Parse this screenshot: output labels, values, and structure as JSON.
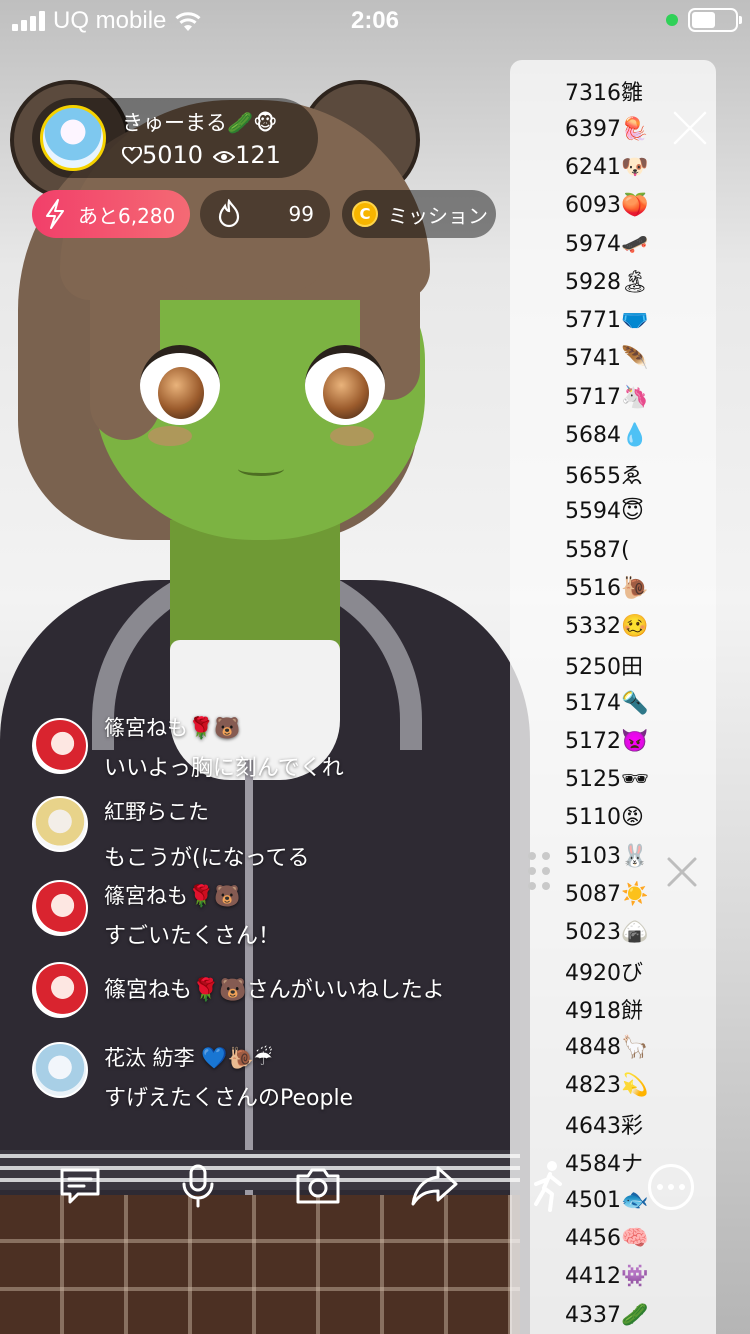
{
  "status_bar": {
    "carrier": "UQ mobile",
    "time": "2:06"
  },
  "streamer": {
    "name": "きゅーまる🥒🐵",
    "likes": "5010",
    "viewers": "121"
  },
  "badges": {
    "remaining": "あと6,280",
    "fire_count": "99",
    "mission": "ミッション",
    "coin_letter": "C"
  },
  "ranking": [
    "7316雛",
    "6397🪼",
    "6241🐶",
    "6093🍑",
    "5974🛹",
    "5928🏝",
    "5771🩲",
    "5741🪶",
    "5717🦄",
    "5684💧",
    "5655ゑ",
    "5594😇",
    "5587(",
    "5516🐌",
    "5332🥴",
    "5250田",
    "5174🔦",
    "5172👿",
    "5125🕶",
    "5110😡",
    "5103🐰",
    "5087☀️",
    "5023🍙",
    "4920び",
    "4918餅",
    "4848🦙",
    "4823💫",
    "4643彩",
    "4584ナ",
    "4501🐟",
    "4456🧠",
    "4412👾",
    "4337🥒"
  ],
  "comments": [
    {
      "name": "篠宮ねも🌹🐻",
      "text": "いいよっ胸に刻んでくれ",
      "avatar": "red"
    },
    {
      "name": "紅野らこた",
      "text": "もこうが(になってる",
      "avatar": "blond"
    },
    {
      "name": "篠宮ねも🌹🐻",
      "text": "すごいたくさん！",
      "avatar": "red"
    },
    {
      "text": "篠宮ねも🌹🐻さんがいいねしたよ",
      "avatar": "red"
    },
    {
      "name": "花汰 紡李 💙🐌☔",
      "text": "すげえたくさんのPeople",
      "avatar": "blue"
    }
  ],
  "colors": {
    "accent": "#f23f6a",
    "coin": "#f7b500",
    "face": "#7cb342"
  },
  "icons": {
    "toolbar": [
      "comment-icon",
      "microphone-icon",
      "camera-icon",
      "share-icon",
      "runner-icon",
      "more-icon"
    ]
  }
}
